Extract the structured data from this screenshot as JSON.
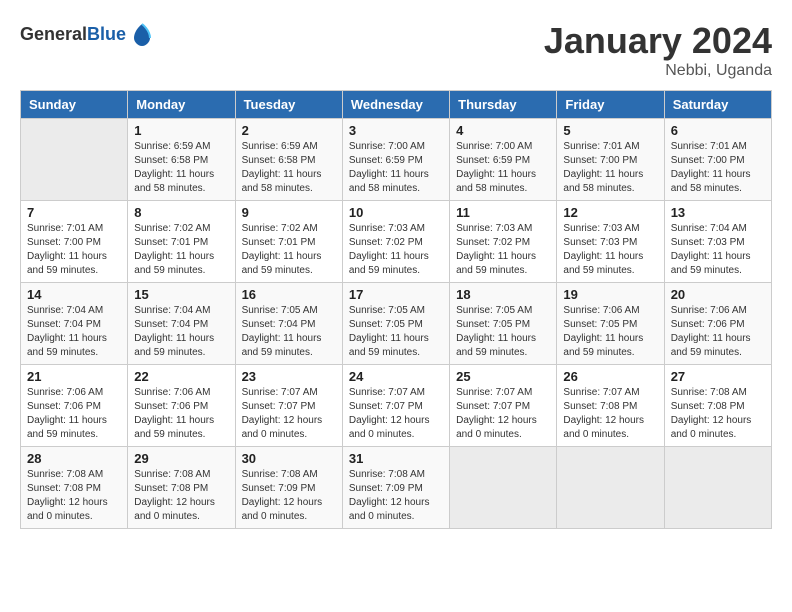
{
  "header": {
    "logo_general": "General",
    "logo_blue": "Blue",
    "month_year": "January 2024",
    "location": "Nebbi, Uganda"
  },
  "days_of_week": [
    "Sunday",
    "Monday",
    "Tuesday",
    "Wednesday",
    "Thursday",
    "Friday",
    "Saturday"
  ],
  "weeks": [
    [
      {
        "day": "",
        "info": ""
      },
      {
        "day": "1",
        "info": "Sunrise: 6:59 AM\nSunset: 6:58 PM\nDaylight: 11 hours\nand 58 minutes."
      },
      {
        "day": "2",
        "info": "Sunrise: 6:59 AM\nSunset: 6:58 PM\nDaylight: 11 hours\nand 58 minutes."
      },
      {
        "day": "3",
        "info": "Sunrise: 7:00 AM\nSunset: 6:59 PM\nDaylight: 11 hours\nand 58 minutes."
      },
      {
        "day": "4",
        "info": "Sunrise: 7:00 AM\nSunset: 6:59 PM\nDaylight: 11 hours\nand 58 minutes."
      },
      {
        "day": "5",
        "info": "Sunrise: 7:01 AM\nSunset: 7:00 PM\nDaylight: 11 hours\nand 58 minutes."
      },
      {
        "day": "6",
        "info": "Sunrise: 7:01 AM\nSunset: 7:00 PM\nDaylight: 11 hours\nand 58 minutes."
      }
    ],
    [
      {
        "day": "7",
        "info": "Sunrise: 7:01 AM\nSunset: 7:00 PM\nDaylight: 11 hours\nand 59 minutes."
      },
      {
        "day": "8",
        "info": "Sunrise: 7:02 AM\nSunset: 7:01 PM\nDaylight: 11 hours\nand 59 minutes."
      },
      {
        "day": "9",
        "info": "Sunrise: 7:02 AM\nSunset: 7:01 PM\nDaylight: 11 hours\nand 59 minutes."
      },
      {
        "day": "10",
        "info": "Sunrise: 7:03 AM\nSunset: 7:02 PM\nDaylight: 11 hours\nand 59 minutes."
      },
      {
        "day": "11",
        "info": "Sunrise: 7:03 AM\nSunset: 7:02 PM\nDaylight: 11 hours\nand 59 minutes."
      },
      {
        "day": "12",
        "info": "Sunrise: 7:03 AM\nSunset: 7:03 PM\nDaylight: 11 hours\nand 59 minutes."
      },
      {
        "day": "13",
        "info": "Sunrise: 7:04 AM\nSunset: 7:03 PM\nDaylight: 11 hours\nand 59 minutes."
      }
    ],
    [
      {
        "day": "14",
        "info": "Sunrise: 7:04 AM\nSunset: 7:04 PM\nDaylight: 11 hours\nand 59 minutes."
      },
      {
        "day": "15",
        "info": "Sunrise: 7:04 AM\nSunset: 7:04 PM\nDaylight: 11 hours\nand 59 minutes."
      },
      {
        "day": "16",
        "info": "Sunrise: 7:05 AM\nSunset: 7:04 PM\nDaylight: 11 hours\nand 59 minutes."
      },
      {
        "day": "17",
        "info": "Sunrise: 7:05 AM\nSunset: 7:05 PM\nDaylight: 11 hours\nand 59 minutes."
      },
      {
        "day": "18",
        "info": "Sunrise: 7:05 AM\nSunset: 7:05 PM\nDaylight: 11 hours\nand 59 minutes."
      },
      {
        "day": "19",
        "info": "Sunrise: 7:06 AM\nSunset: 7:05 PM\nDaylight: 11 hours\nand 59 minutes."
      },
      {
        "day": "20",
        "info": "Sunrise: 7:06 AM\nSunset: 7:06 PM\nDaylight: 11 hours\nand 59 minutes."
      }
    ],
    [
      {
        "day": "21",
        "info": "Sunrise: 7:06 AM\nSunset: 7:06 PM\nDaylight: 11 hours\nand 59 minutes."
      },
      {
        "day": "22",
        "info": "Sunrise: 7:06 AM\nSunset: 7:06 PM\nDaylight: 11 hours\nand 59 minutes."
      },
      {
        "day": "23",
        "info": "Sunrise: 7:07 AM\nSunset: 7:07 PM\nDaylight: 12 hours\nand 0 minutes."
      },
      {
        "day": "24",
        "info": "Sunrise: 7:07 AM\nSunset: 7:07 PM\nDaylight: 12 hours\nand 0 minutes."
      },
      {
        "day": "25",
        "info": "Sunrise: 7:07 AM\nSunset: 7:07 PM\nDaylight: 12 hours\nand 0 minutes."
      },
      {
        "day": "26",
        "info": "Sunrise: 7:07 AM\nSunset: 7:08 PM\nDaylight: 12 hours\nand 0 minutes."
      },
      {
        "day": "27",
        "info": "Sunrise: 7:08 AM\nSunset: 7:08 PM\nDaylight: 12 hours\nand 0 minutes."
      }
    ],
    [
      {
        "day": "28",
        "info": "Sunrise: 7:08 AM\nSunset: 7:08 PM\nDaylight: 12 hours\nand 0 minutes."
      },
      {
        "day": "29",
        "info": "Sunrise: 7:08 AM\nSunset: 7:08 PM\nDaylight: 12 hours\nand 0 minutes."
      },
      {
        "day": "30",
        "info": "Sunrise: 7:08 AM\nSunset: 7:09 PM\nDaylight: 12 hours\nand 0 minutes."
      },
      {
        "day": "31",
        "info": "Sunrise: 7:08 AM\nSunset: 7:09 PM\nDaylight: 12 hours\nand 0 minutes."
      },
      {
        "day": "",
        "info": ""
      },
      {
        "day": "",
        "info": ""
      },
      {
        "day": "",
        "info": ""
      }
    ]
  ]
}
